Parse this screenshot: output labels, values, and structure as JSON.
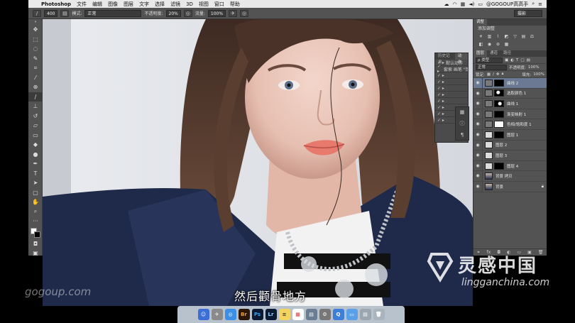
{
  "menubar": {
    "app": "Photoshop",
    "items": [
      "文件",
      "编辑",
      "图像",
      "图层",
      "文字",
      "选择",
      "滤镜",
      "3D",
      "视图",
      "窗口",
      "帮助"
    ],
    "user": "@GOGOUP高高手"
  },
  "options": {
    "brush_size": "400",
    "mode_label": "模式:",
    "mode_value": "正常",
    "opacity_label": "不透明度:",
    "opacity_value": "20%",
    "flow_label": "流量:",
    "flow_value": "100%",
    "workspace": "摄影"
  },
  "adjust_panel": {
    "tabs": [
      "调整"
    ],
    "title": "添加调整"
  },
  "history_panel": {
    "tabs": [
      "历史记录",
      "动作"
    ],
    "first_row": "默认动作",
    "second_row": "套索 画笔 \"饱和..."
  },
  "layers_panel": {
    "tabs": [
      "图层",
      "通道",
      "路径"
    ],
    "kind": "类型",
    "blend": "正常",
    "opacity_label": "不透明度:",
    "opacity_value": "100%",
    "lock_label": "锁定:",
    "fill_label": "填充:",
    "fill_value": "100%",
    "layers": [
      {
        "name": "曲线 2",
        "selected": true,
        "mask": "black"
      },
      {
        "name": "选取颜色 1",
        "selected": false,
        "mask": "speckle"
      },
      {
        "name": "曲线 1",
        "selected": false,
        "mask": "speckle"
      },
      {
        "name": "渐变映射 1",
        "selected": false,
        "mask": "black"
      },
      {
        "name": "色相/饱和度 1",
        "selected": false,
        "mask": "white"
      },
      {
        "name": "图层 1",
        "selected": false,
        "mask": "black"
      },
      {
        "name": "图层 2",
        "selected": false,
        "mask": "none"
      },
      {
        "name": "图层 3",
        "selected": false,
        "mask": "none"
      },
      {
        "name": "图层 4",
        "selected": false,
        "mask": "black"
      },
      {
        "name": "背景 拷贝",
        "selected": false,
        "mask": "none"
      },
      {
        "name": "背景",
        "selected": false,
        "mask": "none",
        "locked": true
      }
    ]
  },
  "subtitle": "然后颧骨地方",
  "watermark_left": "gogoup.com",
  "watermark_right_big": "灵感中国",
  "watermark_right_small": "lingganchina.com",
  "dock": [
    "Br",
    "Ps",
    "Lr"
  ],
  "colors": {
    "panel_bg": "#535353",
    "selected_layer": "#6b7a92",
    "coat_navy": "#1f2a4a"
  }
}
